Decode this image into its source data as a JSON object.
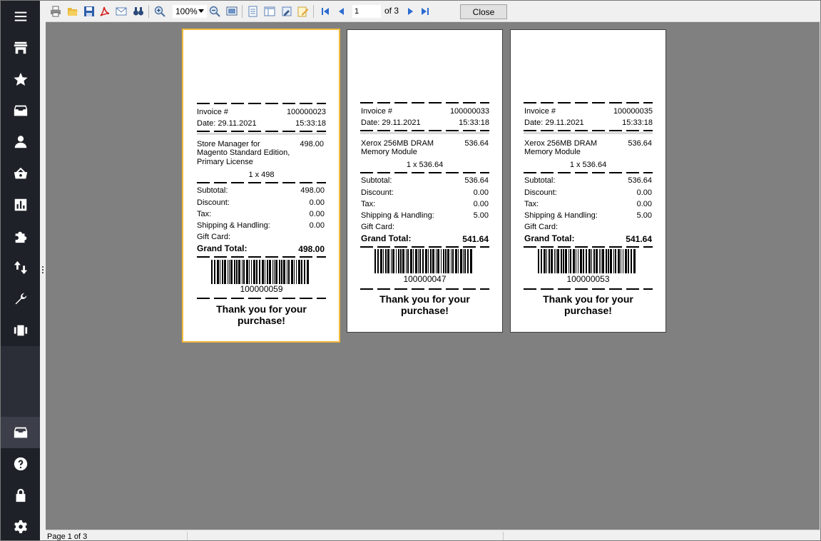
{
  "sidebar": {
    "items": [
      {
        "icon": "menu-icon"
      },
      {
        "icon": "store-icon"
      },
      {
        "icon": "star-icon"
      },
      {
        "icon": "archive-icon"
      },
      {
        "icon": "user-icon"
      },
      {
        "icon": "basket-icon"
      },
      {
        "icon": "chart-icon"
      },
      {
        "icon": "puzzle-icon"
      },
      {
        "icon": "transfer-icon"
      },
      {
        "icon": "wrench-icon"
      },
      {
        "icon": "carousel-icon"
      }
    ],
    "bottom_items": [
      {
        "icon": "archive-icon"
      },
      {
        "icon": "help-icon"
      },
      {
        "icon": "lock-icon"
      },
      {
        "icon": "gear-icon"
      }
    ]
  },
  "toolbar": {
    "zoom": "100%",
    "page_number": "1",
    "page_of": "of 3",
    "close_label": "Close"
  },
  "receipts": [
    {
      "invoice_label": "Invoice #",
      "invoice_number": "100000023",
      "date": "Date: 29.11.2021",
      "time": "15:33:18",
      "item_lines": [
        "Store Manager for",
        "Magento Standard Edition,",
        "Primary License"
      ],
      "item_price": "498.00",
      "qty_line": "1 x 498",
      "subtotal_label": "Subtotal:",
      "subtotal": "498.00",
      "discount_label": "Discount:",
      "discount": "0.00",
      "tax_label": "Tax:",
      "tax": "0.00",
      "shipping_label": "Shipping & Handling:",
      "shipping": "0.00",
      "giftcard_label": "Gift Card:",
      "grand_total_label": "Grand Total:",
      "grand_total": "498.00",
      "barcode_number": "100000059",
      "thanks_line1": "Thank you for your",
      "thanks_line2": "purchase!"
    },
    {
      "invoice_label": "Invoice #",
      "invoice_number": "100000033",
      "date": "Date: 29.11.2021",
      "time": "15:33:18",
      "item_lines": [
        "Xerox 256MB DRAM",
        "Memory Module"
      ],
      "item_price": "536.64",
      "qty_line": "1 x 536.64",
      "subtotal_label": "Subtotal:",
      "subtotal": "536.64",
      "discount_label": "Discount:",
      "discount": "0.00",
      "tax_label": "Tax:",
      "tax": "0.00",
      "shipping_label": "Shipping & Handling:",
      "shipping": "5.00",
      "giftcard_label": "Gift Card:",
      "grand_total_label": "Grand Total:",
      "grand_total": "541.64",
      "barcode_number": "100000047",
      "thanks_line1": "Thank you for your",
      "thanks_line2": "purchase!"
    },
    {
      "invoice_label": "Invoice #",
      "invoice_number": "100000035",
      "date": "Date: 29.11.2021",
      "time": "15:33:18",
      "item_lines": [
        "Xerox 256MB DRAM",
        "Memory Module"
      ],
      "item_price": "536.64",
      "qty_line": "1 x 536.64",
      "subtotal_label": "Subtotal:",
      "subtotal": "536.64",
      "discount_label": "Discount:",
      "discount": "0.00",
      "tax_label": "Tax:",
      "tax": "0.00",
      "shipping_label": "Shipping & Handling:",
      "shipping": "5.00",
      "giftcard_label": "Gift Card:",
      "grand_total_label": "Grand Total:",
      "grand_total": "541.64",
      "barcode_number": "100000053",
      "thanks_line1": "Thank you for your",
      "thanks_line2": "purchase!"
    }
  ],
  "statusbar": {
    "page_status": "Page 1 of 3"
  },
  "colors": {
    "sidebar_bg": "#1f2128",
    "preview_bg": "#808080",
    "selected_page_border": "#f0b93a"
  }
}
